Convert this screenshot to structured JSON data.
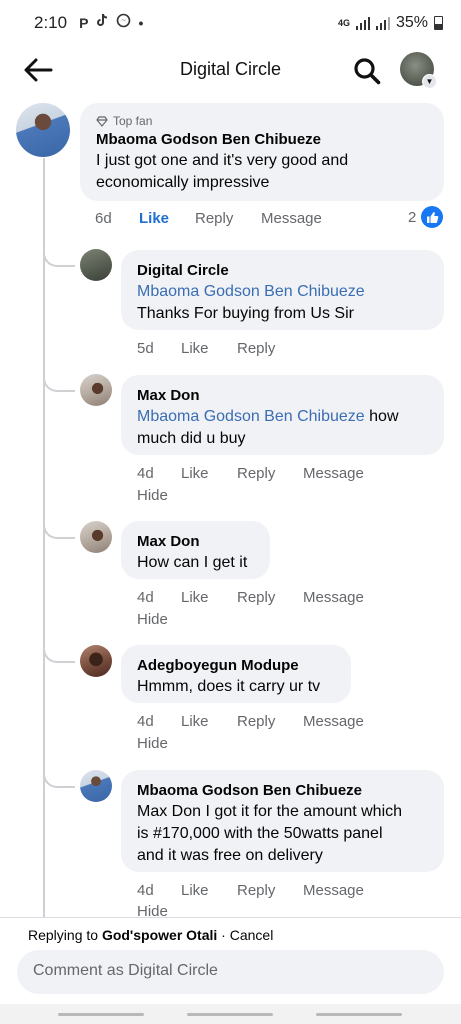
{
  "status_bar": {
    "time": "2:10",
    "left_icons": [
      "P",
      "tiktok-icon",
      "messenger-icon",
      "•"
    ],
    "network": "4G",
    "battery": "35%"
  },
  "header": {
    "title": "Digital Circle"
  },
  "comments": [
    {
      "badge": "Top fan",
      "name": "Mbaoma Godson Ben Chibueze",
      "text": "I just got one and it's very good and economically impressive",
      "text_lines": [
        "I just got one and it's very good and",
        "economically impressive"
      ],
      "time": "6d",
      "like": "Like",
      "reply": "Reply",
      "message": "Message",
      "reaction_count": "2"
    },
    {
      "name": "Digital Circle",
      "mention": "Mbaoma Godson Ben Chibueze",
      "text": "Thanks For buying from Us Sir",
      "time": "5d",
      "like": "Like",
      "reply": "Reply"
    },
    {
      "name": "Max Don",
      "mention": "Mbaoma Godson Ben Chibueze",
      "text_inline": " how",
      "text": "much did u buy",
      "time": "4d",
      "like": "Like",
      "reply": "Reply",
      "message": "Message",
      "hide": "Hide"
    },
    {
      "name": "Max Don",
      "text": "How can I get it",
      "time": "4d",
      "like": "Like",
      "reply": "Reply",
      "message": "Message",
      "hide": "Hide"
    },
    {
      "name": "Adegboyegun Modupe",
      "text": "Hmmm, does it carry ur tv",
      "time": "4d",
      "like": "Like",
      "reply": "Reply",
      "message": "Message",
      "hide": "Hide"
    },
    {
      "name": "Mbaoma Godson Ben Chibueze",
      "text_lines": [
        "Max Don I got it for the amount which",
        "is #170,000 with the 50watts panel",
        "and it was free on delivery"
      ],
      "time": "4d",
      "like": "Like",
      "reply": "Reply",
      "message": "Message",
      "hide": "Hide"
    }
  ],
  "reply_bar": {
    "prefix": "Replying to",
    "target": "God'spower Otali",
    "separator": "·",
    "cancel": "Cancel"
  },
  "composer": {
    "placeholder": "Comment as Digital Circle"
  },
  "colors": {
    "bubble": "#f0f2f5",
    "mention": "#3b6db3",
    "like_active": "#1f6fd1",
    "like_reaction": "#1877f2",
    "muted": "#65676b"
  }
}
